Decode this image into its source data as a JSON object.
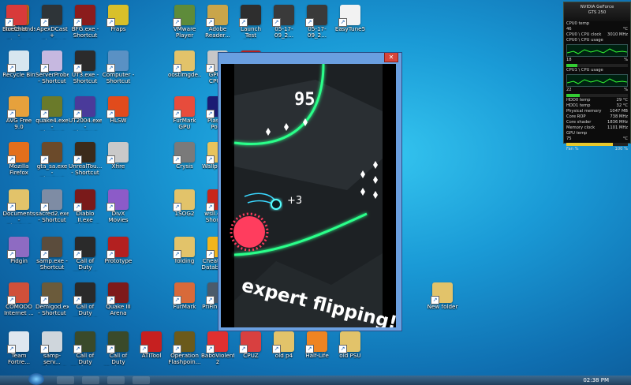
{
  "desktop_icons": [
    {
      "label": "Borderlands -\nShortcut",
      "color": "#b5631b"
    },
    {
      "label": "ApexDCast +\n- Shortcut",
      "color": "#2e3438"
    },
    {
      "label": "BFG.exe -\nShortcut",
      "color": "#8b1c1c"
    },
    {
      "label": "Fraps",
      "color": "#d8c02a"
    },
    {
      "label": "VMware\nPlayer",
      "color": "#5e8b3a"
    },
    {
      "label": "Adobe\nReader...",
      "color": "#c9a54a"
    },
    {
      "label": "Launch Test\nDrive Unli...",
      "color": "#2e2e2e"
    },
    {
      "label": "05-17-09_2...",
      "color": "#3a3a3a"
    },
    {
      "label": "05-17-09_2...",
      "color": "#3a3a3a"
    },
    {
      "label": "EasyTune5",
      "color": "#f2f2f2"
    },
    {
      "label": "IceChat",
      "color": "#d83a3a"
    },
    {
      "label": "Recycle Bin",
      "color": "#d7e6ef"
    },
    {
      "label": "ServerProbe\n- Shortcut",
      "color": "#c6b8e0"
    },
    {
      "label": "UT3.exe -\nShortcut",
      "color": "#2b2b2b"
    },
    {
      "label": "Computer -\nShortcut",
      "color": "#5a91c4"
    },
    {
      "label": "oostlmgde...",
      "color": "#e2c36a"
    },
    {
      "label": "GPU-Z\nCPU-Z",
      "color": "#c7c7c7"
    },
    {
      "label": "Adobe\nReader...",
      "color": "#b62020"
    },
    {
      "label": "AVG Free 9.0",
      "color": "#e6a13c"
    },
    {
      "label": "quake4.exe -\nShortcut",
      "color": "#6a7a2a"
    },
    {
      "label": "UT2004.exe -\nShortcut",
      "color": "#4a3a9a"
    },
    {
      "label": "HLSW",
      "color": "#e14b1c"
    },
    {
      "label": "FurMark GPU",
      "color": "#e74c3c"
    },
    {
      "label": "Plasma Pong",
      "color": "#1b1b74"
    },
    {
      "label": "Micro\nKeybo...",
      "color": "#9aa3ad"
    },
    {
      "label": "Mozilla\nFirefox",
      "color": "#e36f1c"
    },
    {
      "label": "gta_sa.exe -\nShortcut",
      "color": "#6b4a2a"
    },
    {
      "label": "UnrealTou...\n- Shortcut",
      "color": "#3b2b1b"
    },
    {
      "label": "Xfire",
      "color": "#c9c9c9"
    },
    {
      "label": "Crysis",
      "color": "#7a7a7a"
    },
    {
      "label": "Wallpapers",
      "color": "#e8c35c"
    },
    {
      "label": "Geck",
      "color": "#8a8a8a"
    },
    {
      "label": "Documents -\nShortcut",
      "color": "#e2c36a"
    },
    {
      "label": "sacred2.exe\n- Shortcut",
      "color": "#7e8ca4"
    },
    {
      "label": "Diablo II.exe\n- Shortcut",
      "color": "#7a1a1a"
    },
    {
      "label": "DivX Movies",
      "color": "#8c5bc8"
    },
    {
      "label": "1SOG2",
      "color": "#e2c36a"
    },
    {
      "label": "wsll.exe -\nShortcut",
      "color": "#c8261b"
    },
    {
      "label": "3DMark...\n- Short",
      "color": "#ef8421"
    },
    {
      "label": "Pidgin",
      "color": "#8e6bc2"
    },
    {
      "label": "samp.exe -\nShortcut",
      "color": "#5b4c3c"
    },
    {
      "label": "Call of Duty\nWorld at W...",
      "color": "#2a2a2a"
    },
    {
      "label": "Prototype",
      "color": "#b32020"
    },
    {
      "label": "folding",
      "color": "#e2c36a"
    },
    {
      "label": "Cheatbook\nDatabase...",
      "color": "#f2b51c"
    },
    {
      "label": "Wirele...",
      "color": "#5b8ec5"
    },
    {
      "label": "COMODO\nInternet ...",
      "color": "#d0503a"
    },
    {
      "label": "Demigod.exe\n- Shortcut",
      "color": "#6b5b3b"
    },
    {
      "label": "Call of Duty\nWorld at W...",
      "color": "#2a2a2a"
    },
    {
      "label": "Quake III\nArena",
      "color": "#7e1a1a"
    },
    {
      "label": "FurMark",
      "color": "#d86a3a"
    },
    {
      "label": "PriFinity2...",
      "color": "#4b5b6b"
    },
    {
      "label": "CPU...",
      "color": "#d44040"
    },
    {
      "label": "New folder",
      "color": "#e2c36a"
    },
    {
      "label": "Team\nFortre...",
      "color": "#dfe7ef"
    },
    {
      "label": "samp-serv...\n- Shortcut",
      "color": "#cfd6dc"
    },
    {
      "label": "Call of Duty\nModern ...",
      "color": "#3a4a2a"
    },
    {
      "label": "Call of Duty\nModern ...",
      "color": "#3a4a2a"
    },
    {
      "label": "ATITool",
      "color": "#c62020"
    },
    {
      "label": "Operation\nFlashpoin...",
      "color": "#6b5a1b"
    },
    {
      "label": "BaboViolent\n2",
      "color": "#e03030"
    },
    {
      "label": "CPUZ",
      "color": "#d84040"
    },
    {
      "label": "old p4",
      "color": "#e2c36a"
    },
    {
      "label": "Half-Life",
      "color": "#ef8421"
    },
    {
      "label": "old PSU",
      "color": "#e2c36a"
    }
  ],
  "gadget": {
    "title": "NVIDIA GeForce",
    "model": "GTS 250",
    "rows": [
      {
        "k": "CPU0 temp",
        "v": "",
        "v2": ""
      },
      {
        "k": "46",
        "v": "°C",
        "v2": ""
      },
      {
        "k": "CPU0 \\ CPU clock",
        "v": "3010",
        "v2": "MHz"
      },
      {
        "k": "CPU0 \\ CPU usage",
        "v": "",
        "v2": ""
      },
      {
        "k": "18",
        "v": "%",
        "v2": ""
      },
      {
        "k": "CPU1 \\ CPU usage",
        "v": "",
        "v2": ""
      },
      {
        "k": "22",
        "v": "%",
        "v2": ""
      },
      {
        "k": "HDD0 temp",
        "v": "29",
        "v2": "°C"
      },
      {
        "k": "HDD1 temp",
        "v": "32",
        "v2": "°C"
      },
      {
        "k": "Physical memory",
        "v": "1047",
        "v2": "MB"
      },
      {
        "k": "Core ROP",
        "v": "738",
        "v2": "MHz"
      },
      {
        "k": "Core shader",
        "v": "1836",
        "v2": "MHz"
      },
      {
        "k": "Memory clock",
        "v": "1101",
        "v2": "MHz"
      },
      {
        "k": "GPU temp",
        "v": "",
        "v2": ""
      },
      {
        "k": "75",
        "v": "°C",
        "v2": ""
      },
      {
        "k": "Fan %",
        "v": "100",
        "v2": "%"
      }
    ],
    "cpu0_usage": 0.18,
    "cpu1_usage": 0.22,
    "gpu_temp_level": 0.75
  },
  "game_window": {
    "close_label": "✕",
    "score": "95",
    "bonus": "+3",
    "message": "expert flipping!"
  },
  "taskbar": {
    "clock_time": "02:38 PM"
  }
}
